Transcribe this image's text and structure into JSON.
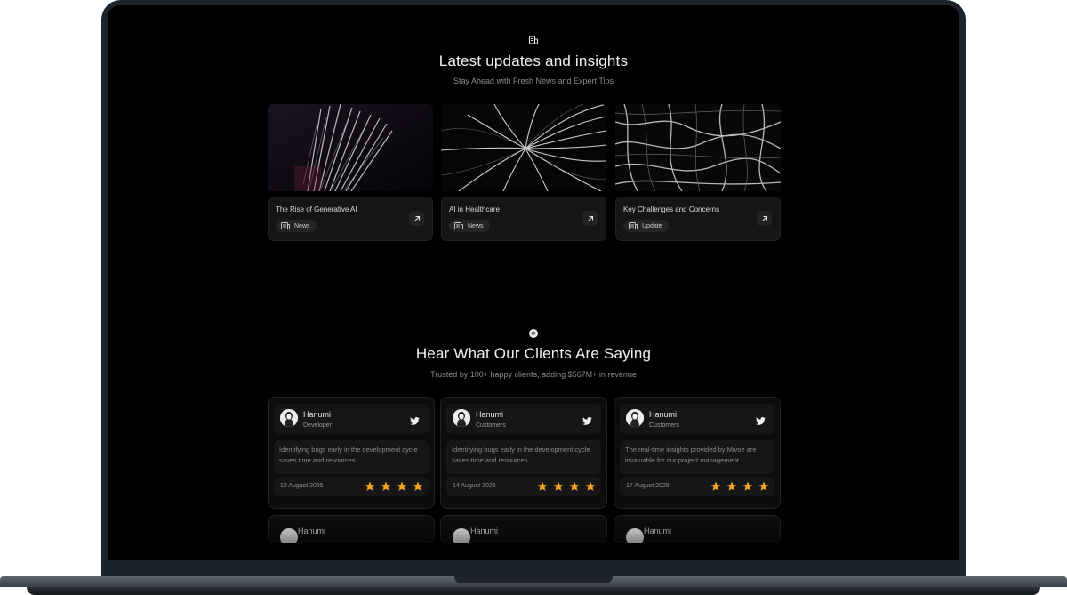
{
  "updates": {
    "icon": "news-icon",
    "title": "Latest updates and insights",
    "subtitle": "Stay Ahead with Fresh News and Expert Tips",
    "cards": [
      {
        "title": "The Rise of Generative AI",
        "tag": "News"
      },
      {
        "title": "AI in Healthcare",
        "tag": "News"
      },
      {
        "title": "Key Challenges and Concerns",
        "tag": "Update"
      }
    ]
  },
  "testimonials": {
    "icon": "chat-bubble-icon",
    "title": "Hear What Our Clients Are Saying",
    "subtitle": "Trusted by 100+ happy clients, adding $567M+ in revenue",
    "cards": [
      {
        "name": "Hanumi",
        "role": "Developer",
        "quote": "Identifying bugs early in the development cycle saves time and resources",
        "date": "12 August 2025",
        "stars": 4
      },
      {
        "name": "Hanumi",
        "role": "Customers",
        "quote": "Identifying bugs early in the development cycle saves time and resources",
        "date": "14 August 2025",
        "stars": 4
      },
      {
        "name": "Hanumi",
        "role": "Customers",
        "quote": "The real-time insights provided by Mivoe are invaluable for our project management.",
        "date": "17 August 2025",
        "stars": 4
      }
    ],
    "partial_cards": [
      {
        "name": "Hanumi"
      },
      {
        "name": "Hanumi"
      },
      {
        "name": "Hanumi"
      }
    ]
  },
  "colors": {
    "star": "#f5a623",
    "background": "#000000",
    "card": "#161616"
  }
}
